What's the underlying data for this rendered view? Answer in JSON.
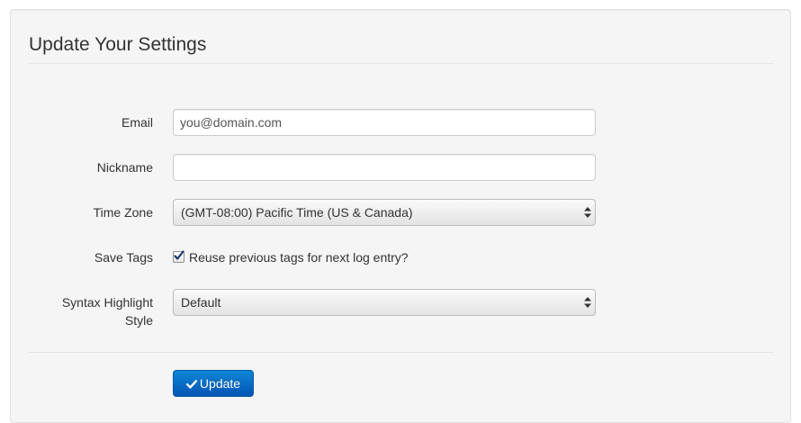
{
  "form": {
    "title": "Update Your Settings",
    "fields": {
      "email": {
        "label": "Email",
        "value": "you@domain.com"
      },
      "nickname": {
        "label": "Nickname",
        "value": ""
      },
      "time_zone": {
        "label": "Time Zone",
        "selected": "(GMT-08:00) Pacific Time (US & Canada)"
      },
      "save_tags": {
        "label": "Save Tags",
        "option_label": "Reuse previous tags for next log entry?",
        "checked": true
      },
      "syntax_highlight": {
        "label_line1": "Syntax Highlight",
        "label_line2": "Style",
        "selected": "Default"
      }
    },
    "submit_label": "Update"
  },
  "colors": {
    "primary_button": "#0774c9",
    "well_background": "#f5f5f5"
  },
  "icons": {
    "submit": "check-icon",
    "select": "select-arrows-icon",
    "checkbox": "checkmark-icon"
  }
}
